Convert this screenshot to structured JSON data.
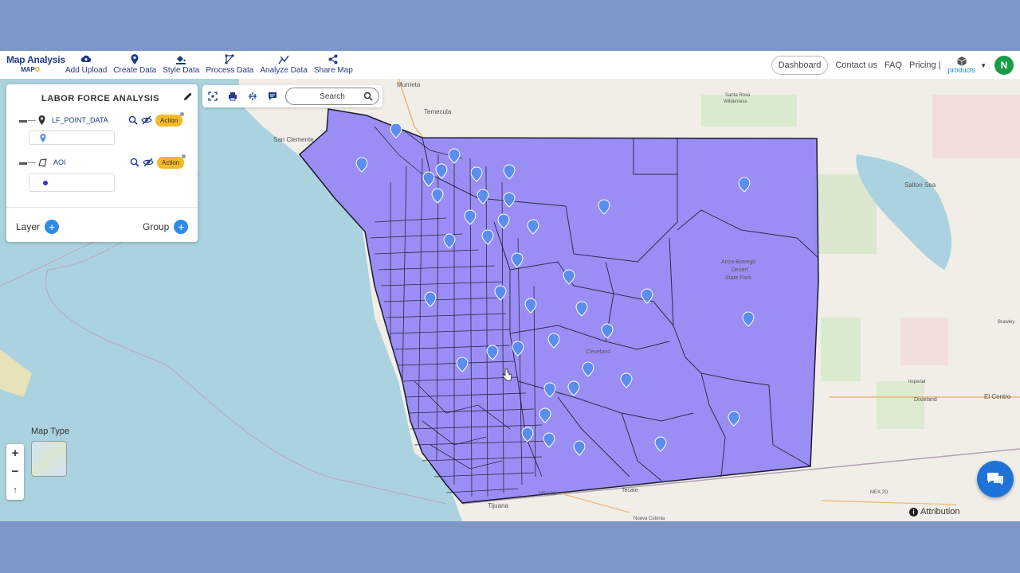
{
  "brand": {
    "title": "Map Analysis",
    "sub_prefix": "MAP",
    "sub_suffix": "O"
  },
  "nav": {
    "items": [
      {
        "label": "Add Upload",
        "icon": "cloud-upload-icon"
      },
      {
        "label": "Create Data",
        "icon": "location-pin-icon"
      },
      {
        "label": "Style Data",
        "icon": "paint-bucket-icon"
      },
      {
        "label": "Process Data",
        "icon": "process-nodes-icon"
      },
      {
        "label": "Analyze Data",
        "icon": "analyze-chart-icon"
      },
      {
        "label": "Share Map",
        "icon": "share-icon"
      }
    ],
    "dashboard": "Dashboard",
    "contact": "Contact us",
    "faq": "FAQ",
    "pricing": "Pricing |",
    "products": "products",
    "avatar_initial": "N"
  },
  "panel": {
    "title": "LABOR FORCE ANALYSIS",
    "layers": [
      {
        "name": "LF_POINT_DATA",
        "type_icon": "point-layer-icon",
        "action": "Action"
      },
      {
        "name": "AOI",
        "type_icon": "polygon-layer-icon",
        "action": "Action"
      }
    ],
    "layer_button": "Layer",
    "group_button": "Group"
  },
  "toolbar": {
    "search_label": "Search"
  },
  "map": {
    "map_type_label": "Map Type",
    "attribution": "Attribution",
    "polygon_fill": "#8b7cf6",
    "marker_color": "#5b8def",
    "labels": {
      "murrieta": "Murrieta",
      "temecula": "Temecula",
      "san_clemente": "San Clemente",
      "salton_sea": "Salton Sea",
      "santa_rosa": "Santa Rosa",
      "santa_rosa_2": "Wilderness",
      "el_centro": "El Centro",
      "tijuana": "Tijuana",
      "tecate": "Tecate",
      "dixieland": "Dixieland",
      "anza_borrego": "Anza-Borrego",
      "anza_borrego_2": "Desert",
      "anza_borrego_3": "State Park",
      "cleveland": "Cleveland",
      "brawley": "Brawley",
      "mex_2d": "MEX 2D",
      "mex_2d_b": "MEX 2D",
      "nueva_colonia": "Nueva Colonia",
      "imperial": "Imperial"
    }
  }
}
